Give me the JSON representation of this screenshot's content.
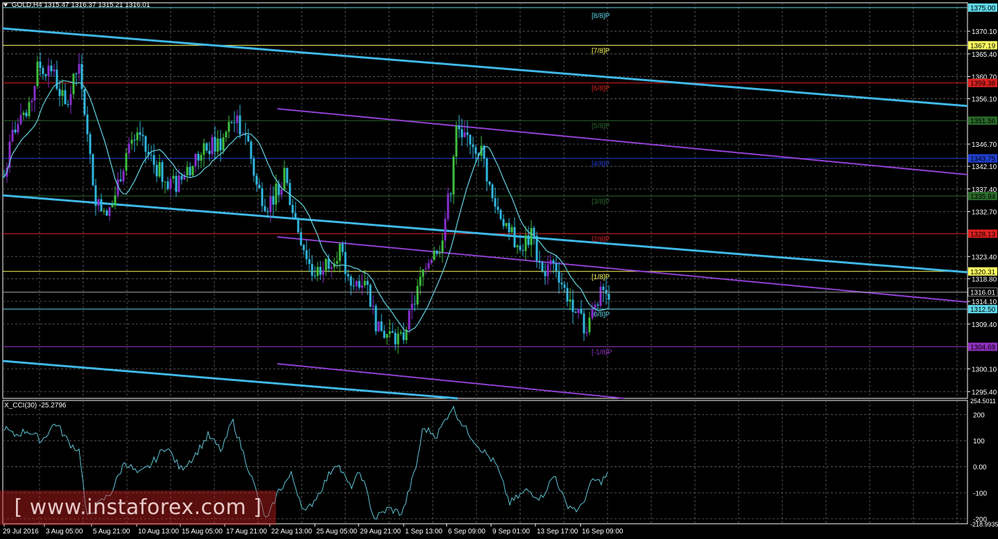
{
  "header": {
    "symbol": "GOLD,H4",
    "ohlc": "1315.47 1316.37 1315.21 1316.01"
  },
  "cci": {
    "label": "X_CCI(30) -25.2796",
    "scale_labels": [
      "254.5011",
      "200",
      "100",
      "0.00",
      "-100",
      "-200",
      "-218.9935"
    ],
    "color": "#5fc8d8"
  },
  "watermark": "[ www.instaforex.com ]",
  "price_axis": [
    "1370.10",
    "1365.40",
    "1360.70",
    "1356.10",
    "1346.70",
    "1342.10",
    "1337.40",
    "1332.70",
    "1323.40",
    "1318.80",
    "1314.10",
    "1309.40",
    "1300.10",
    "1295.40"
  ],
  "murrey_levels": [
    {
      "label": "[8/8]P",
      "price": "1375.00",
      "color": "#5fd8e8",
      "badge_bg": "#5fd8e8",
      "badge_fg": "#000"
    },
    {
      "label": "[7/8]P",
      "price": "1367.19",
      "color": "#ffff60",
      "badge_bg": "#ffff60",
      "badge_fg": "#000"
    },
    {
      "label": "[6/8]P",
      "price": "1359.38",
      "color": "#e02020",
      "badge_bg": "#e02020",
      "badge_fg": "#000"
    },
    {
      "label": "[5/8]P",
      "price": "1351.56",
      "color": "#2a6a2a",
      "badge_bg": "#2a6a2a",
      "badge_fg": "#000"
    },
    {
      "label": "[4/8]P",
      "price": "1343.75",
      "color": "#2040d0",
      "badge_bg": "#2040d0",
      "badge_fg": "#000"
    },
    {
      "label": "[3/8]P",
      "price": "1335.94",
      "color": "#2a6a2a",
      "badge_bg": "#2a6a2a",
      "badge_fg": "#000"
    },
    {
      "label": "[2/8]P",
      "price": "1328.13",
      "color": "#e02020",
      "badge_bg": "#e02020",
      "badge_fg": "#000"
    },
    {
      "label": "[1/8]P",
      "price": "1320.31",
      "color": "#ffff60",
      "badge_bg": "#ffff60",
      "badge_fg": "#000"
    },
    {
      "label": "[0/8]P",
      "price": "1312.50",
      "color": "#5fd8e8",
      "badge_bg": "#5fd8e8",
      "badge_fg": "#000"
    },
    {
      "label": "[-1/8]P",
      "price": "1304.69",
      "color": "#9030c0",
      "badge_bg": "#9030c0",
      "badge_fg": "#000"
    }
  ],
  "current_price": "1316.01",
  "time_axis": [
    "29 Jul 2016",
    "3 Aug 05:00",
    "5 Aug 21:00",
    "10 Aug 13:00",
    "15 Aug 05:00",
    "17 Aug 21:00",
    "22 Aug 13:00",
    "25 Aug 05:00",
    "29 Aug 21:00",
    "1 Sep 13:00",
    "6 Sep 09:00",
    "9 Sep 01:00",
    "13 Sep 17:00",
    "16 Sep 09:00"
  ],
  "colors": {
    "bull_candle": "#40c040",
    "bear_candle": "#30b8e0",
    "bull_candle_alt": "#8a30d0",
    "ma_line": "#5fc8d8",
    "channel_blue": "#40b8e8",
    "channel_purple": "#9040d0",
    "grid": "#6a6a6a"
  }
}
